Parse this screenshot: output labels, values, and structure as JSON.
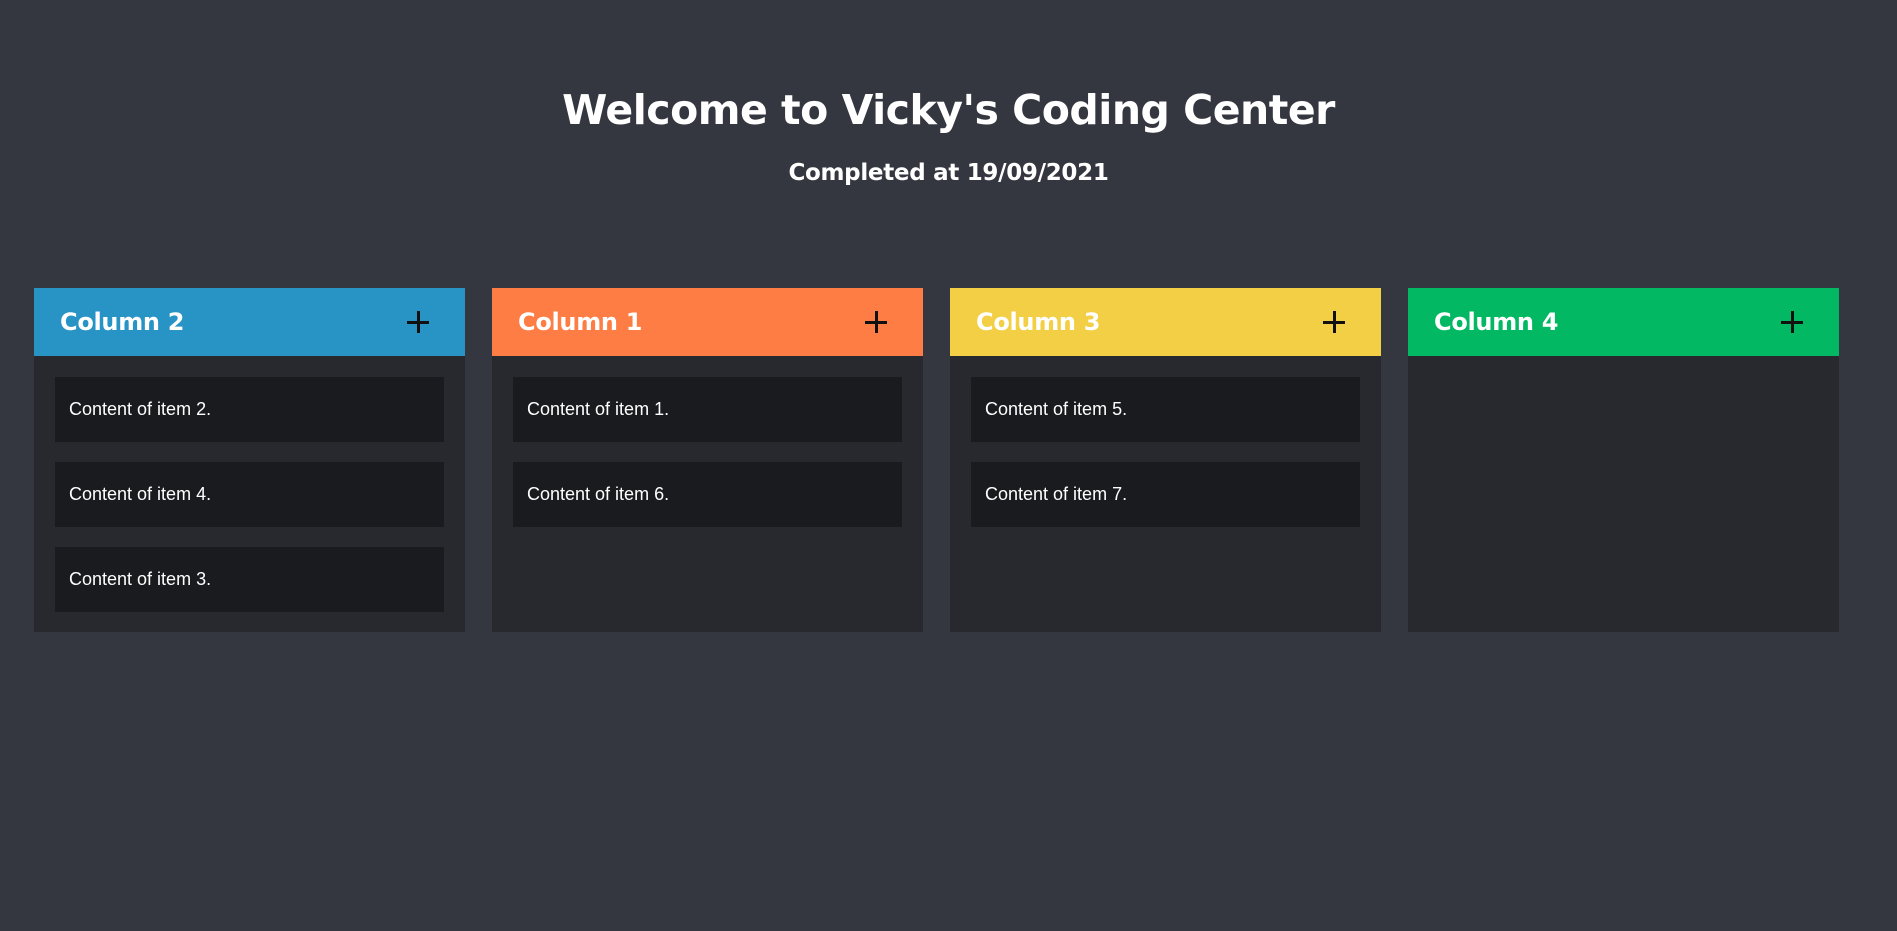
{
  "header": {
    "title": "Welcome to Vicky's Coding Center",
    "subtitle": "Completed at 19/09/2021"
  },
  "columns": [
    {
      "title": "Column 2",
      "color": "#2893c5",
      "items": [
        "Content of item 2.",
        "Content of item 4.",
        "Content of item 3."
      ]
    },
    {
      "title": "Column 1",
      "color": "#fd7d45",
      "items": [
        "Content of item 1.",
        "Content of item 6."
      ]
    },
    {
      "title": "Column 3",
      "color": "#f3cf45",
      "items": [
        "Content of item 5.",
        "Content of item 7."
      ]
    },
    {
      "title": "Column 4",
      "color": "#03b862",
      "items": []
    }
  ],
  "icons": {
    "add": "plus-icon"
  }
}
